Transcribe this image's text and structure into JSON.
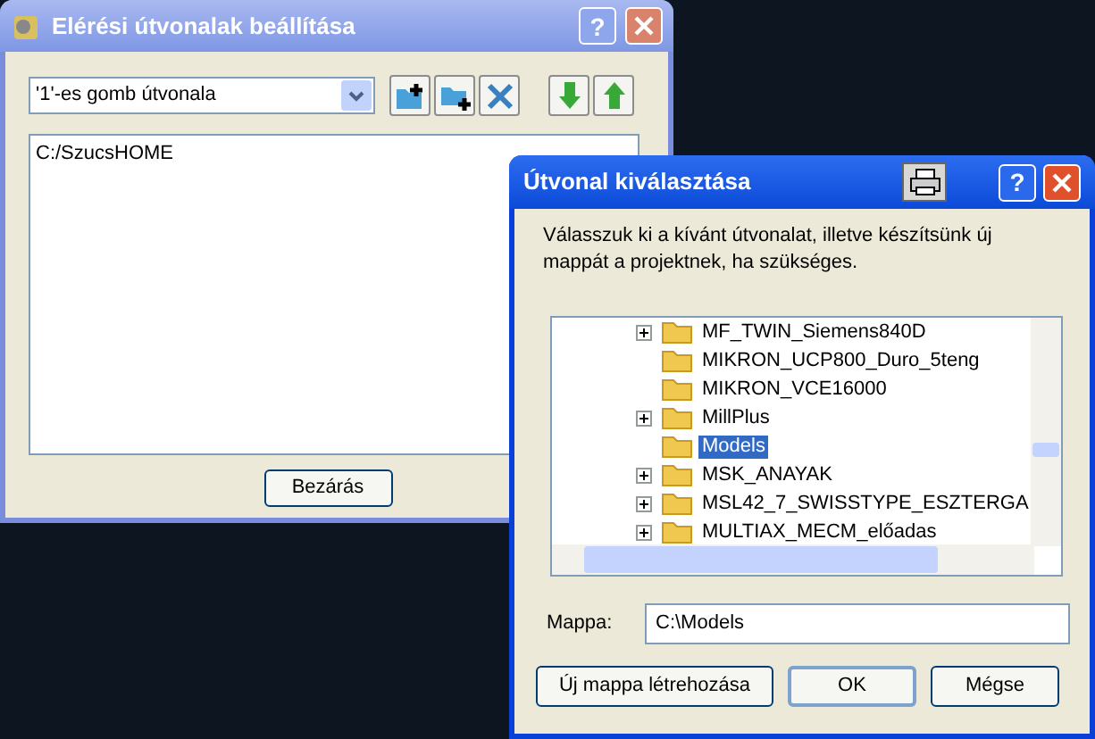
{
  "main_window": {
    "title": "Elérési útvonalak beállítása",
    "dropdown_value": "'1'-es gomb útvonala",
    "paths": [
      "C:/SzucsHOME"
    ],
    "close_button": "Bezárás",
    "help_button": "?"
  },
  "dialog": {
    "title": "Útvonal kiválasztása",
    "help_button": "?",
    "description": "Válasszuk ki a kívánt útvonalat, illetve készítsünk új mappát a projektnek, ha szükséges.",
    "tree": [
      {
        "label": "MF_TWIN_Siemens840D",
        "expandable": true,
        "selected": false
      },
      {
        "label": "MIKRON_UCP800_Duro_5teng",
        "expandable": false,
        "selected": false
      },
      {
        "label": "MIKRON_VCE16000",
        "expandable": false,
        "selected": false
      },
      {
        "label": "MillPlus",
        "expandable": true,
        "selected": false
      },
      {
        "label": "Models",
        "expandable": false,
        "selected": true
      },
      {
        "label": "MSK_ANAYAK",
        "expandable": true,
        "selected": false
      },
      {
        "label": "MSL42_7_SWISSTYPE_ESZTERGA",
        "expandable": true,
        "selected": false
      },
      {
        "label": "MULTIAX_MECM_előadas",
        "expandable": true,
        "selected": false
      }
    ],
    "folder_label": "Mappa:",
    "folder_value": "C:\\Models",
    "buttons": [
      {
        "label": "Új mappa létrehozása",
        "default": false
      },
      {
        "label": "OK",
        "default": true
      },
      {
        "label": "Mégse",
        "default": false
      }
    ]
  }
}
